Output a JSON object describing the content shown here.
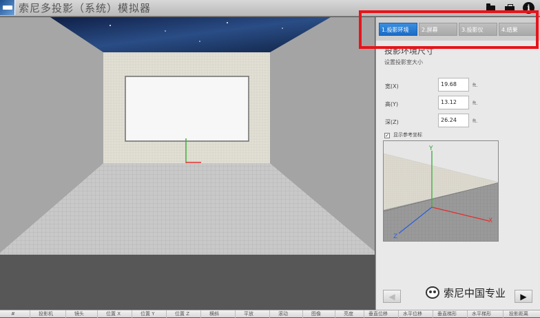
{
  "window": {
    "title": "索尼多投影（系统）模拟器"
  },
  "toolbar": {
    "icons": [
      "folder-icon",
      "toolbox-icon",
      "info-icon"
    ],
    "info_glyph": "i"
  },
  "tabs": [
    {
      "label": "1.投影环境",
      "active": true
    },
    {
      "label": "2.屏幕",
      "active": false
    },
    {
      "label": "3.投影仪",
      "active": false
    },
    {
      "label": "4.结果",
      "active": false
    }
  ],
  "panel": {
    "title": "投影环境尺寸",
    "subtitle": "设置投影室大小",
    "fields": [
      {
        "label": "宽(X)",
        "value": "19.68",
        "unit": "ft."
      },
      {
        "label": "高(Y)",
        "value": "13.12",
        "unit": "ft."
      },
      {
        "label": "深(Z)",
        "value": "26.24",
        "unit": "ft."
      }
    ],
    "show_axes": {
      "label": "显示参考坐标",
      "checked": true,
      "glyph": "✓"
    },
    "preview_axes": {
      "y": "Y",
      "x": "X",
      "z": "Z"
    },
    "prev_glyph": "◀",
    "next_glyph": "▶"
  },
  "watermark": {
    "text": "索尼中国专业"
  },
  "table_columns": [
    "#",
    "投影机",
    "镜头",
    "位置 X",
    "位置 Y",
    "位置 Z",
    "横斜",
    "平放",
    "滚动",
    "图像",
    "亮度",
    "垂直位移",
    "水平位移",
    "垂直梯形",
    "水平梯形",
    "投影距离"
  ],
  "colors": {
    "accent": "#1c6cc4",
    "highlight": "#e8141a"
  }
}
